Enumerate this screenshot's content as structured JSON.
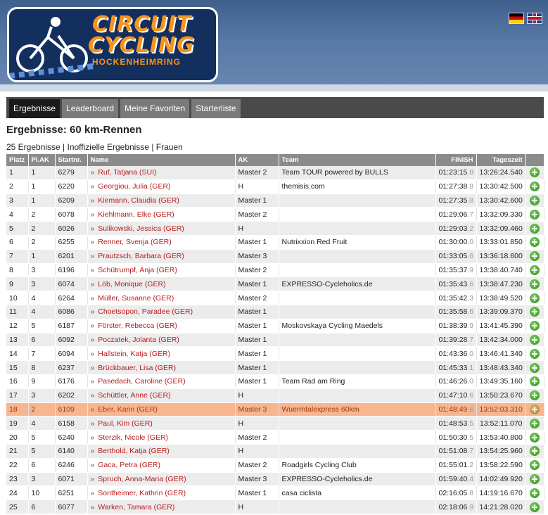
{
  "logo": {
    "line1": "CIRCUIT",
    "line2": "CYCLING",
    "line3": "HOCKENHEIMRING"
  },
  "flags": [
    "flag-de-icon",
    "flag-uk-icon"
  ],
  "nav": {
    "tabs": [
      "Ergebnisse",
      "Leaderboard",
      "Meine Favoriten",
      "Starterliste"
    ],
    "active": 0
  },
  "page": {
    "title": "Ergebnisse: 60 km-Rennen",
    "subtitle": "25 Ergebnisse | Inoffizielle Ergebnisse | Frauen"
  },
  "table": {
    "headers": [
      "Platz",
      "Pl.AK",
      "Startnr.",
      "Name",
      "AK",
      "Team",
      "FINISH",
      "Tageszeit",
      ""
    ],
    "rows": [
      {
        "platz": "1",
        "plak": "1",
        "nr": "6279",
        "name": "Ruf, Tatjana (SUI)",
        "ak": "Master 2",
        "team": "Team TOUR powered by BULLS",
        "finish": "01:23:15",
        "frac": ".8",
        "tz": "13:26:24.540"
      },
      {
        "platz": "2",
        "plak": "1",
        "nr": "6220",
        "name": "Georgiou, Julia (GER)",
        "ak": "H",
        "team": "themisis.com",
        "finish": "01:27:38",
        "frac": ".8",
        "tz": "13:30:42.500"
      },
      {
        "platz": "3",
        "plak": "1",
        "nr": "6209",
        "name": "Kiemann, Claudia (GER)",
        "ak": "Master 1",
        "team": "",
        "finish": "01:27:35",
        "frac": ".8",
        "tz": "13:30:42.600"
      },
      {
        "platz": "4",
        "plak": "2",
        "nr": "6078",
        "name": "Kiehlmann, Elke (GER)",
        "ak": "Master 2",
        "team": "",
        "finish": "01:29:06",
        "frac": ".7",
        "tz": "13:32:09.330"
      },
      {
        "platz": "5",
        "plak": "2",
        "nr": "6026",
        "name": "Sulikowski, Jessica (GER)",
        "ak": "H",
        "team": "",
        "finish": "01:29:03",
        "frac": ".2",
        "tz": "13:32:09.460"
      },
      {
        "platz": "6",
        "plak": "2",
        "nr": "6255",
        "name": "Renner, Svenja (GER)",
        "ak": "Master 1",
        "team": "Nutrixxion Red Fruit",
        "finish": "01:30:00",
        "frac": ".0",
        "tz": "13:33:01.850"
      },
      {
        "platz": "7",
        "plak": "1",
        "nr": "6201",
        "name": "Prautzsch, Barbara (GER)",
        "ak": "Master 3",
        "team": "",
        "finish": "01:33:05",
        "frac": ".6",
        "tz": "13:36:18.600"
      },
      {
        "platz": "8",
        "plak": "3",
        "nr": "6196",
        "name": "Schütrumpf, Anja (GER)",
        "ak": "Master 2",
        "team": "",
        "finish": "01:35:37",
        "frac": ".9",
        "tz": "13:38:40.740"
      },
      {
        "platz": "9",
        "plak": "3",
        "nr": "6074",
        "name": "Löb, Monique (GER)",
        "ak": "Master 1",
        "team": "EXPRESSO-Cycleholics.de",
        "finish": "01:35:43",
        "frac": ".6",
        "tz": "13:38:47.230"
      },
      {
        "platz": "10",
        "plak": "4",
        "nr": "6264",
        "name": "Müller, Susanne (GER)",
        "ak": "Master 2",
        "team": "",
        "finish": "01:35:42",
        "frac": ".3",
        "tz": "13:38:49.520"
      },
      {
        "platz": "11",
        "plak": "4",
        "nr": "6086",
        "name": "Choetsopon, Paradee (GER)",
        "ak": "Master 1",
        "team": "",
        "finish": "01:35:58",
        "frac": ".6",
        "tz": "13:39:09.370"
      },
      {
        "platz": "12",
        "plak": "5",
        "nr": "6187",
        "name": "Förster, Rebecca (GER)",
        "ak": "Master 1",
        "team": "Moskovskaya Cycling Maedels",
        "finish": "01:38:39",
        "frac": ".9",
        "tz": "13:41:45.390"
      },
      {
        "platz": "13",
        "plak": "6",
        "nr": "6092",
        "name": "Poczatek, Jolanta (GER)",
        "ak": "Master 1",
        "team": "",
        "finish": "01:39:28",
        "frac": ".7",
        "tz": "13:42:34.000"
      },
      {
        "platz": "14",
        "plak": "7",
        "nr": "6094",
        "name": "Hallstein, Katja (GER)",
        "ak": "Master 1",
        "team": "",
        "finish": "01:43:36",
        "frac": ".0",
        "tz": "13:46:41.340"
      },
      {
        "platz": "15",
        "plak": "8",
        "nr": "6237",
        "name": "Brückbauer, Lisa (GER)",
        "ak": "Master 1",
        "team": "",
        "finish": "01:45:33",
        "frac": ".1",
        "tz": "13:48:43.340"
      },
      {
        "platz": "16",
        "plak": "9",
        "nr": "6176",
        "name": "Pasedach, Caroline (GER)",
        "ak": "Master 1",
        "team": "Team Rad am Ring",
        "finish": "01:46:26",
        "frac": ".0",
        "tz": "13:49:35.160"
      },
      {
        "platz": "17",
        "plak": "3",
        "nr": "6202",
        "name": "Schüttler, Anne (GER)",
        "ak": "H",
        "team": "",
        "finish": "01:47:10",
        "frac": ".6",
        "tz": "13:50:23.670"
      },
      {
        "platz": "18",
        "plak": "2",
        "nr": "6109",
        "name": "Eber, Karin (GER)",
        "ak": "Master 3",
        "team": "Wuermtalexpress 60km",
        "finish": "01:48:49",
        "frac": ".6",
        "tz": "13:52:03.310",
        "highlight": true
      },
      {
        "platz": "19",
        "plak": "4",
        "nr": "6158",
        "name": "Paul, Kim (GER)",
        "ak": "H",
        "team": "",
        "finish": "01:48:53",
        "frac": ".5",
        "tz": "13:52:11.070"
      },
      {
        "platz": "20",
        "plak": "5",
        "nr": "6240",
        "name": "Sterzik, Nicole (GER)",
        "ak": "Master 2",
        "team": "",
        "finish": "01:50:30",
        "frac": ".5",
        "tz": "13:53:40.800"
      },
      {
        "platz": "21",
        "plak": "5",
        "nr": "6140",
        "name": "Berthold, Katja (GER)",
        "ak": "H",
        "team": "",
        "finish": "01:51:08",
        "frac": ".7",
        "tz": "13:54:25.960"
      },
      {
        "platz": "22",
        "plak": "6",
        "nr": "6246",
        "name": "Gaca, Petra (GER)",
        "ak": "Master 2",
        "team": "Roadgirls Cycling Club",
        "finish": "01:55:01",
        "frac": ".2",
        "tz": "13:58:22.590"
      },
      {
        "platz": "23",
        "plak": "3",
        "nr": "6071",
        "name": "Spruch, Anna-Maria (GER)",
        "ak": "Master 3",
        "team": "EXPRESSO-Cycleholics.de",
        "finish": "01:59:40",
        "frac": ".4",
        "tz": "14:02:49.920"
      },
      {
        "platz": "24",
        "plak": "10",
        "nr": "6251",
        "name": "Sontheimer, Kathrin (GER)",
        "ak": "Master 1",
        "team": "casa ciclista",
        "finish": "02:16:05",
        "frac": ".8",
        "tz": "14:19:16.670"
      },
      {
        "platz": "25",
        "plak": "6",
        "nr": "6077",
        "name": "Warken, Tamara (GER)",
        "ak": "H",
        "team": "",
        "finish": "02:18:06",
        "frac": ".9",
        "tz": "14:21:28.020"
      }
    ]
  }
}
